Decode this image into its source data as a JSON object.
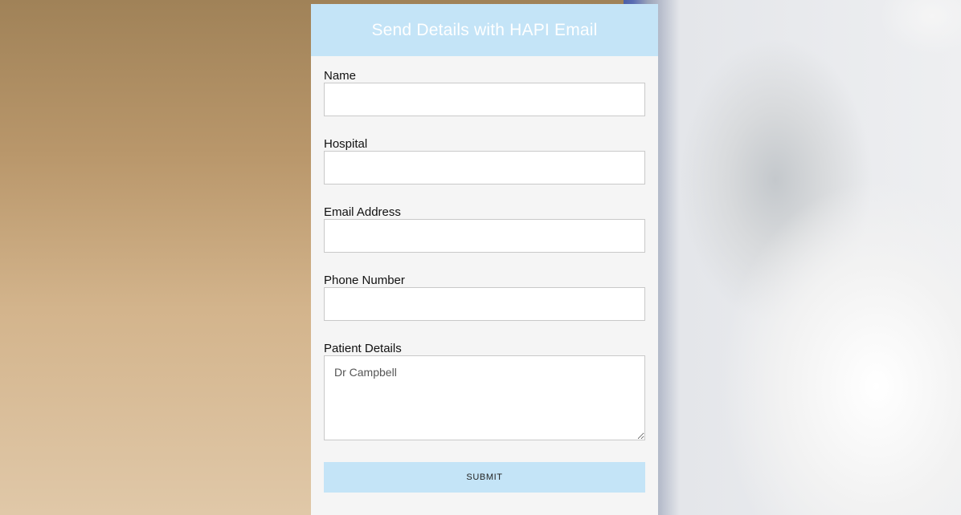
{
  "form": {
    "title": "Send Details with HAPI Email",
    "fields": [
      {
        "label": "Name",
        "value": "",
        "placeholder": ""
      },
      {
        "label": "Hospital",
        "value": "",
        "placeholder": ""
      },
      {
        "label": "Email Address",
        "value": "",
        "placeholder": ""
      },
      {
        "label": "Phone Number",
        "value": "",
        "placeholder": ""
      }
    ],
    "patient_details": {
      "label": "Patient Details",
      "placeholder": "Dr Campbell"
    },
    "submit_label": "SUBMIT"
  },
  "colors": {
    "header_bg": "#c4e4f7",
    "card_bg": "#f5f5f5",
    "submit_bg": "#c4e4f7"
  }
}
